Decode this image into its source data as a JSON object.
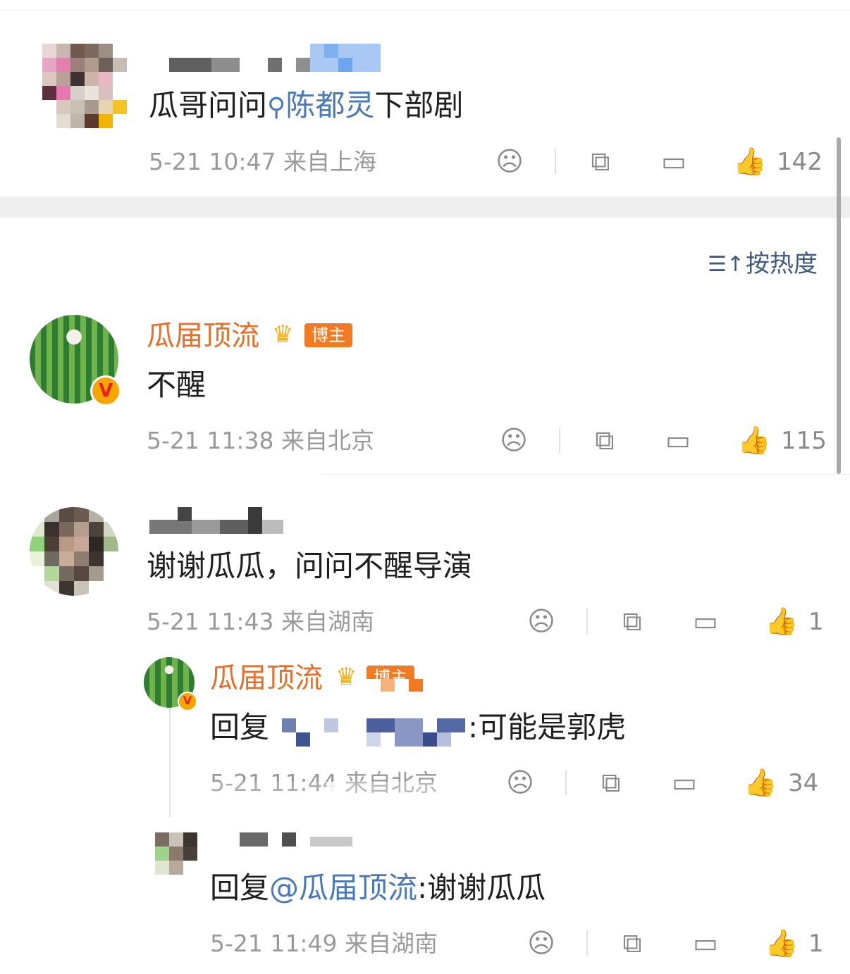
{
  "post": {
    "text_prefix": "瓜哥问问",
    "topic": "陈都灵",
    "text_suffix": "下部剧",
    "meta": "5-21 10:47  来自上海",
    "likes": "142"
  },
  "sort_label": "按热度",
  "comments": [
    {
      "username": "瓜届顶流",
      "badge": "博主",
      "text": "不醒",
      "meta": "5-21 11:38  来自北京",
      "likes": "115"
    },
    {
      "text": "谢谢瓜瓜，问问不醒导演",
      "meta": "5-21 11:43  来自湖南",
      "likes": "1",
      "replies": [
        {
          "username": "瓜届顶流",
          "badge": "博主",
          "text_prefix": "回复",
          "text_suffix": ":可能是郭虎",
          "meta": "5-21 11:44  来自北京",
          "likes": "34"
        },
        {
          "text_prefix": "回复",
          "mention": "@瓜届顶流",
          "text_suffix": ":谢谢瓜瓜",
          "meta": "5-21 11:49  来自湖南",
          "likes": "1"
        }
      ]
    }
  ],
  "icons": {
    "dislike": "sad-face-icon",
    "share": "share-icon",
    "comment": "comment-icon",
    "like": "thumbs-up-icon",
    "sort": "sort-icon"
  },
  "colors": {
    "username": "#e86f27",
    "link": "#4a79b8",
    "badge": "#f07b22",
    "meta": "#9a9a9a"
  }
}
